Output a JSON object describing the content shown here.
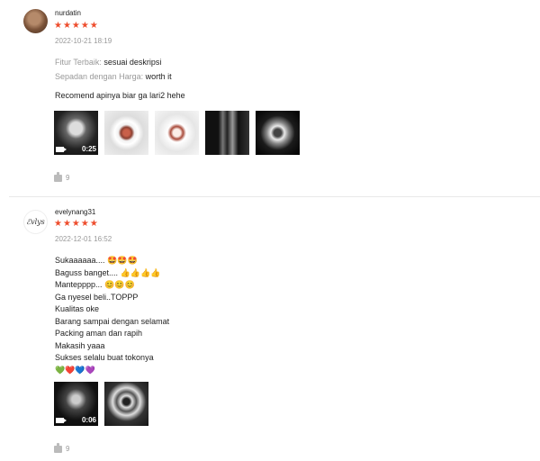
{
  "reviews": [
    {
      "username": "nurdatin",
      "stars": "★★★★★",
      "date": "2022-10-21 18:19",
      "attributes": [
        {
          "key": "Fitur Terbaik:",
          "value": "sesuai deskripsi"
        },
        {
          "key": "Sepadan dengan Harga:",
          "value": "worth it"
        }
      ],
      "comment": [
        "Recomend apinya biar ga lari2 hehe"
      ],
      "media": [
        {
          "icon": "video-camera-icon",
          "duration": "0:25"
        },
        {
          "icon": "photo"
        },
        {
          "icon": "photo"
        },
        {
          "icon": "photo"
        },
        {
          "icon": "photo"
        }
      ],
      "likes": "9"
    },
    {
      "username": "evelynang31",
      "avatar_text": "ℰvlys",
      "stars": "★★★★★",
      "date": "2022-12-01 16:52",
      "comment": [
        "Sukaaaaaa.... 🤩🤩🤩",
        "Baguss banget.... 👍👍👍👍",
        "Mantepppp... 😊😊😊",
        "Ga nyesel beli..TOPPP",
        "Kualitas oke",
        "Barang sampai dengan selamat",
        "Packing aman dan rapih",
        "Makasih yaaa",
        "Sukses selalu buat tokonya",
        "💚❤️💙💜"
      ],
      "media": [
        {
          "icon": "video-camera-icon",
          "duration": "0:06"
        },
        {
          "icon": "photo"
        }
      ],
      "likes": "9"
    }
  ],
  "colors": {
    "star": "#ee4d2d",
    "muted": "#999999",
    "divider": "#e8e8e8"
  }
}
